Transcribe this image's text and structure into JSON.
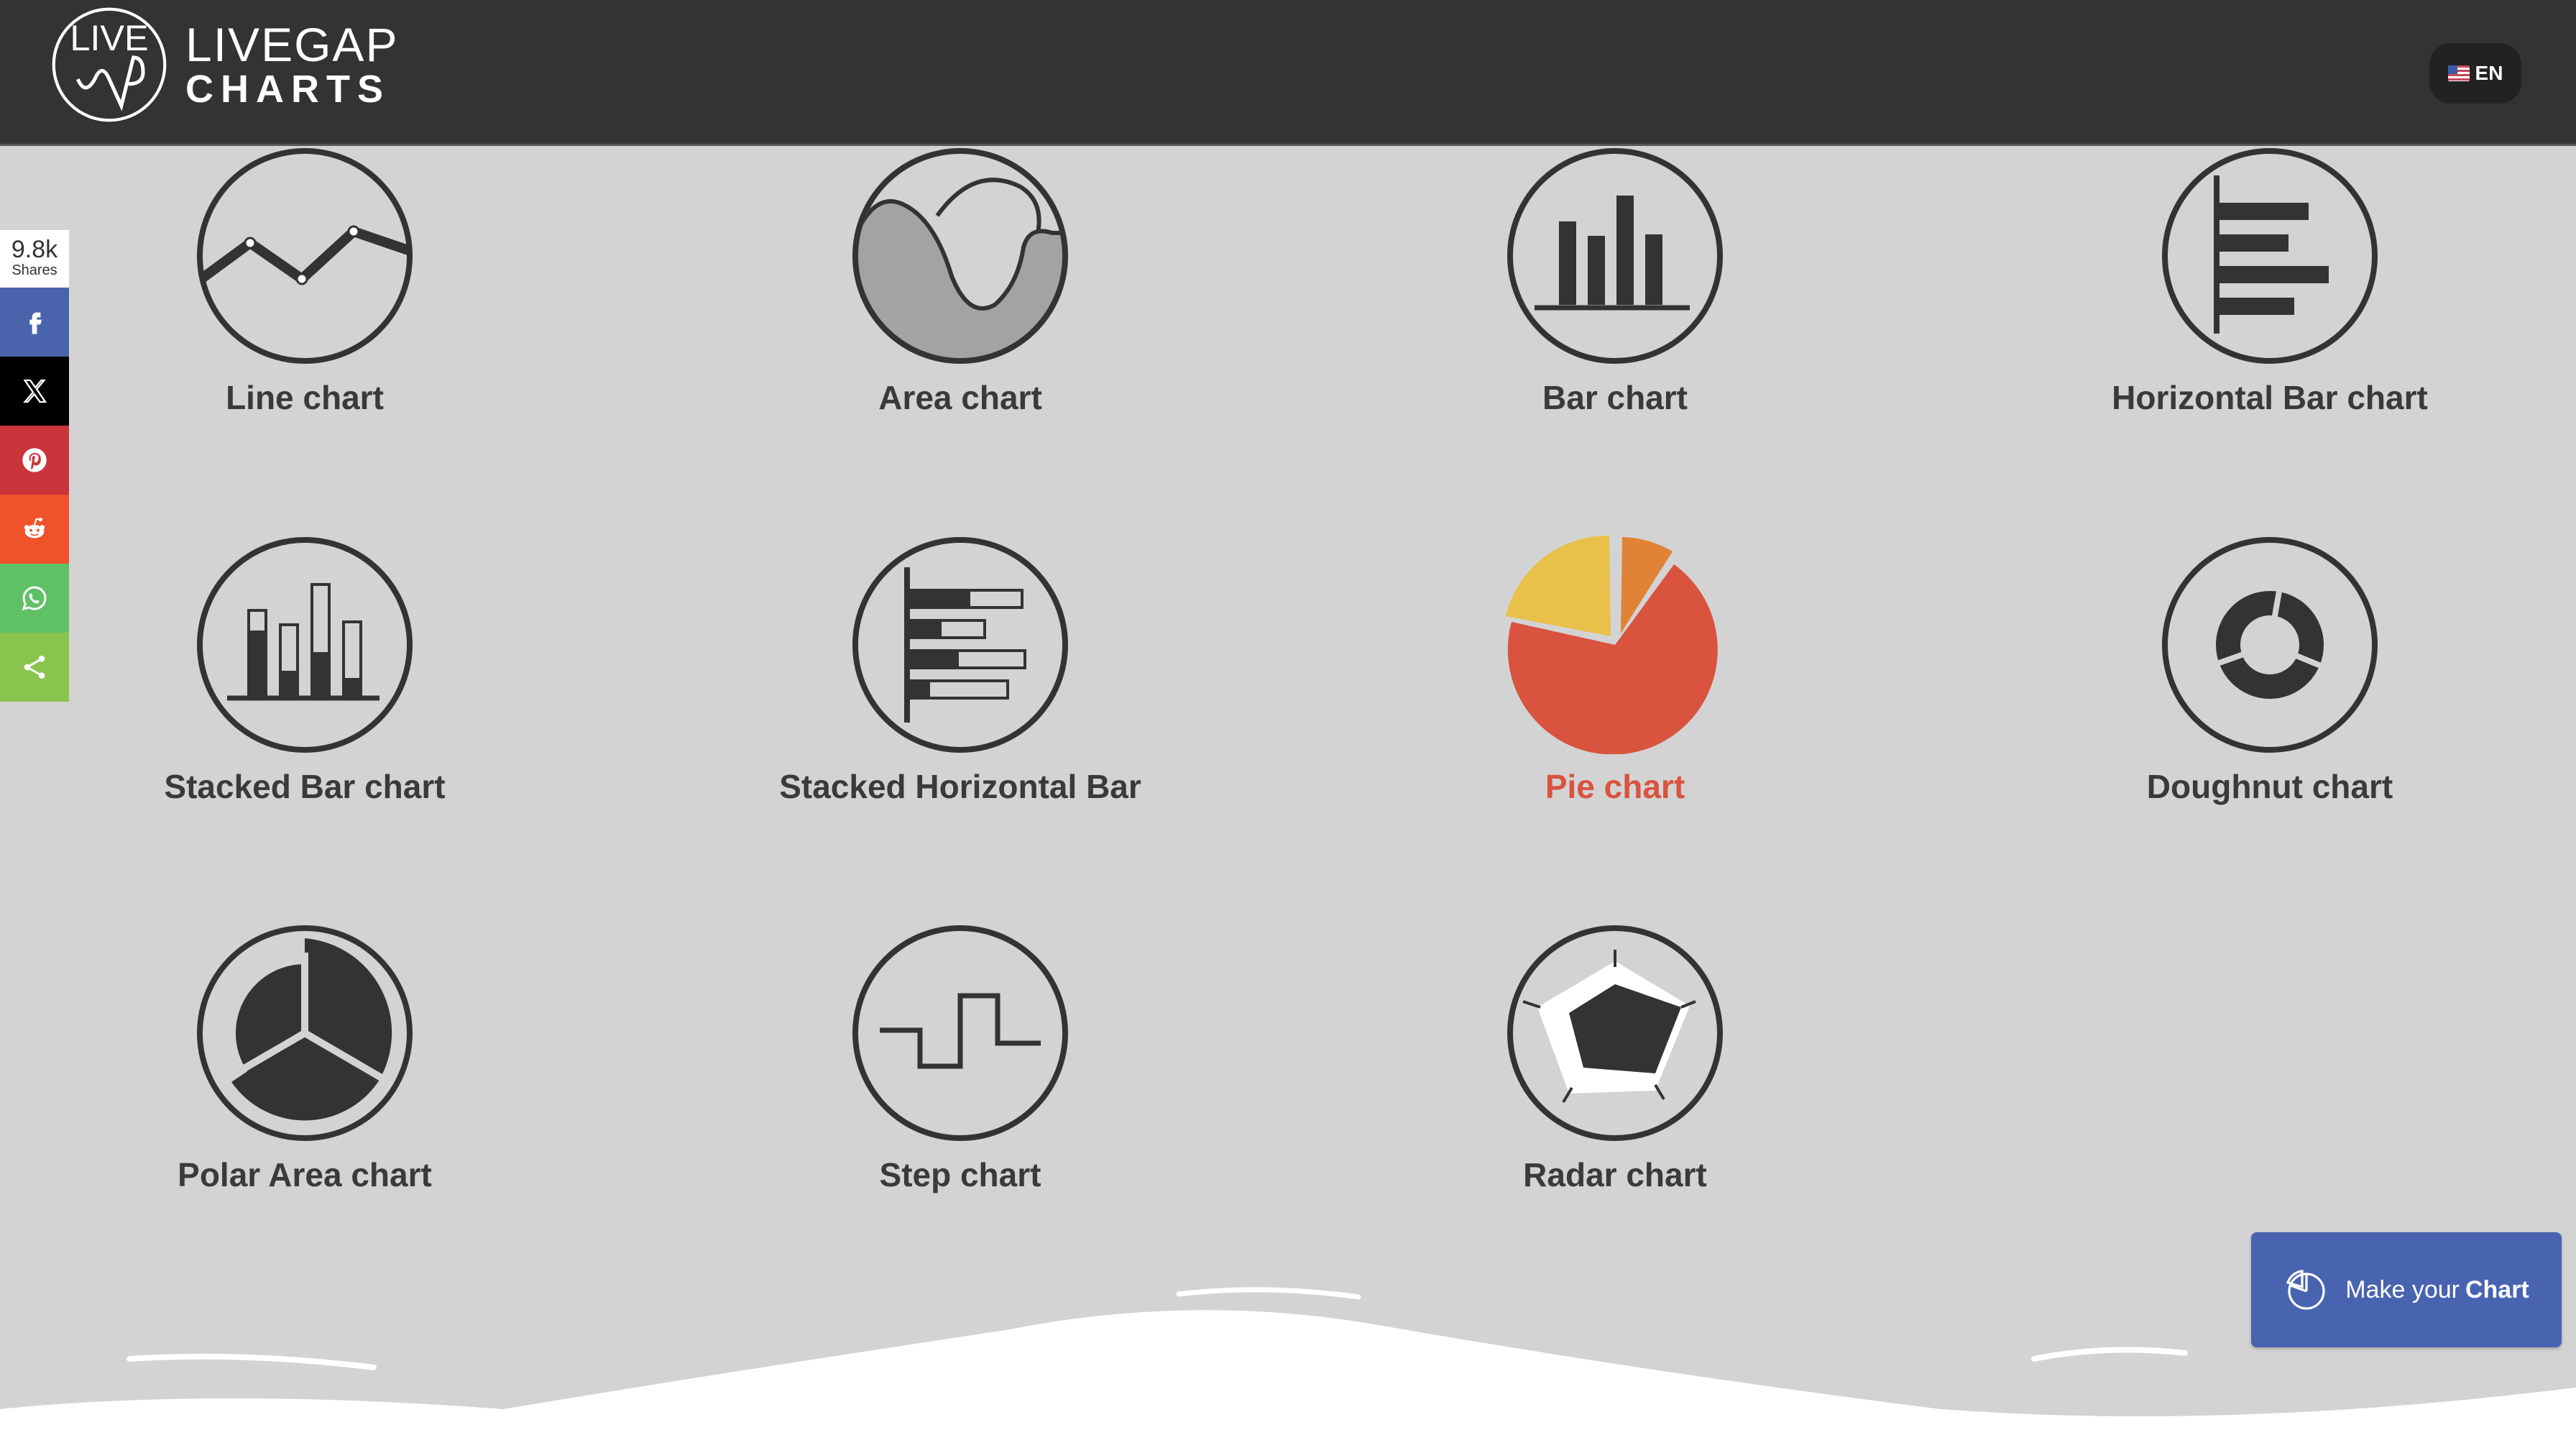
{
  "header": {
    "logo_line1": "LIVEGAP",
    "logo_line2": "CHARTS",
    "language": "EN"
  },
  "share_bar": {
    "count": "9.8k",
    "count_label": "Shares",
    "networks": [
      {
        "name": "facebook",
        "color": "#4964ad"
      },
      {
        "name": "x",
        "color": "#000000"
      },
      {
        "name": "pinterest",
        "color": "#c9353a"
      },
      {
        "name": "reddit",
        "color": "#f0522a"
      },
      {
        "name": "whatsapp",
        "color": "#5fc066"
      },
      {
        "name": "share",
        "color": "#89c44e"
      }
    ]
  },
  "chart_types": [
    {
      "label": "Line chart",
      "icon": "line-chart-icon"
    },
    {
      "label": "Area chart",
      "icon": "area-chart-icon"
    },
    {
      "label": "Bar chart",
      "icon": "bar-chart-icon"
    },
    {
      "label": "Horizontal Bar chart",
      "icon": "horizontal-bar-chart-icon"
    },
    {
      "label": "Stacked Bar chart",
      "icon": "stacked-bar-chart-icon"
    },
    {
      "label": "Stacked Horizontal Bar",
      "icon": "stacked-horizontal-bar-icon"
    },
    {
      "label": "Pie chart",
      "icon": "pie-chart-icon",
      "active": true
    },
    {
      "label": "Doughnut chart",
      "icon": "doughnut-chart-icon"
    },
    {
      "label": "Polar Area chart",
      "icon": "polar-area-chart-icon"
    },
    {
      "label": "Step chart",
      "icon": "step-chart-icon"
    },
    {
      "label": "Radar chart",
      "icon": "radar-chart-icon"
    }
  ],
  "cta": {
    "prefix": "Make your",
    "bold": "Chart"
  },
  "colors": {
    "header_bg": "#333333",
    "page_bg": "#d3d3d3",
    "icon_stroke": "#333333",
    "active_label": "#d9533e",
    "pie_red": "#d9533e",
    "pie_yellow": "#e9c04a",
    "pie_orange": "#e08336",
    "cta_bg": "#4864b1"
  }
}
